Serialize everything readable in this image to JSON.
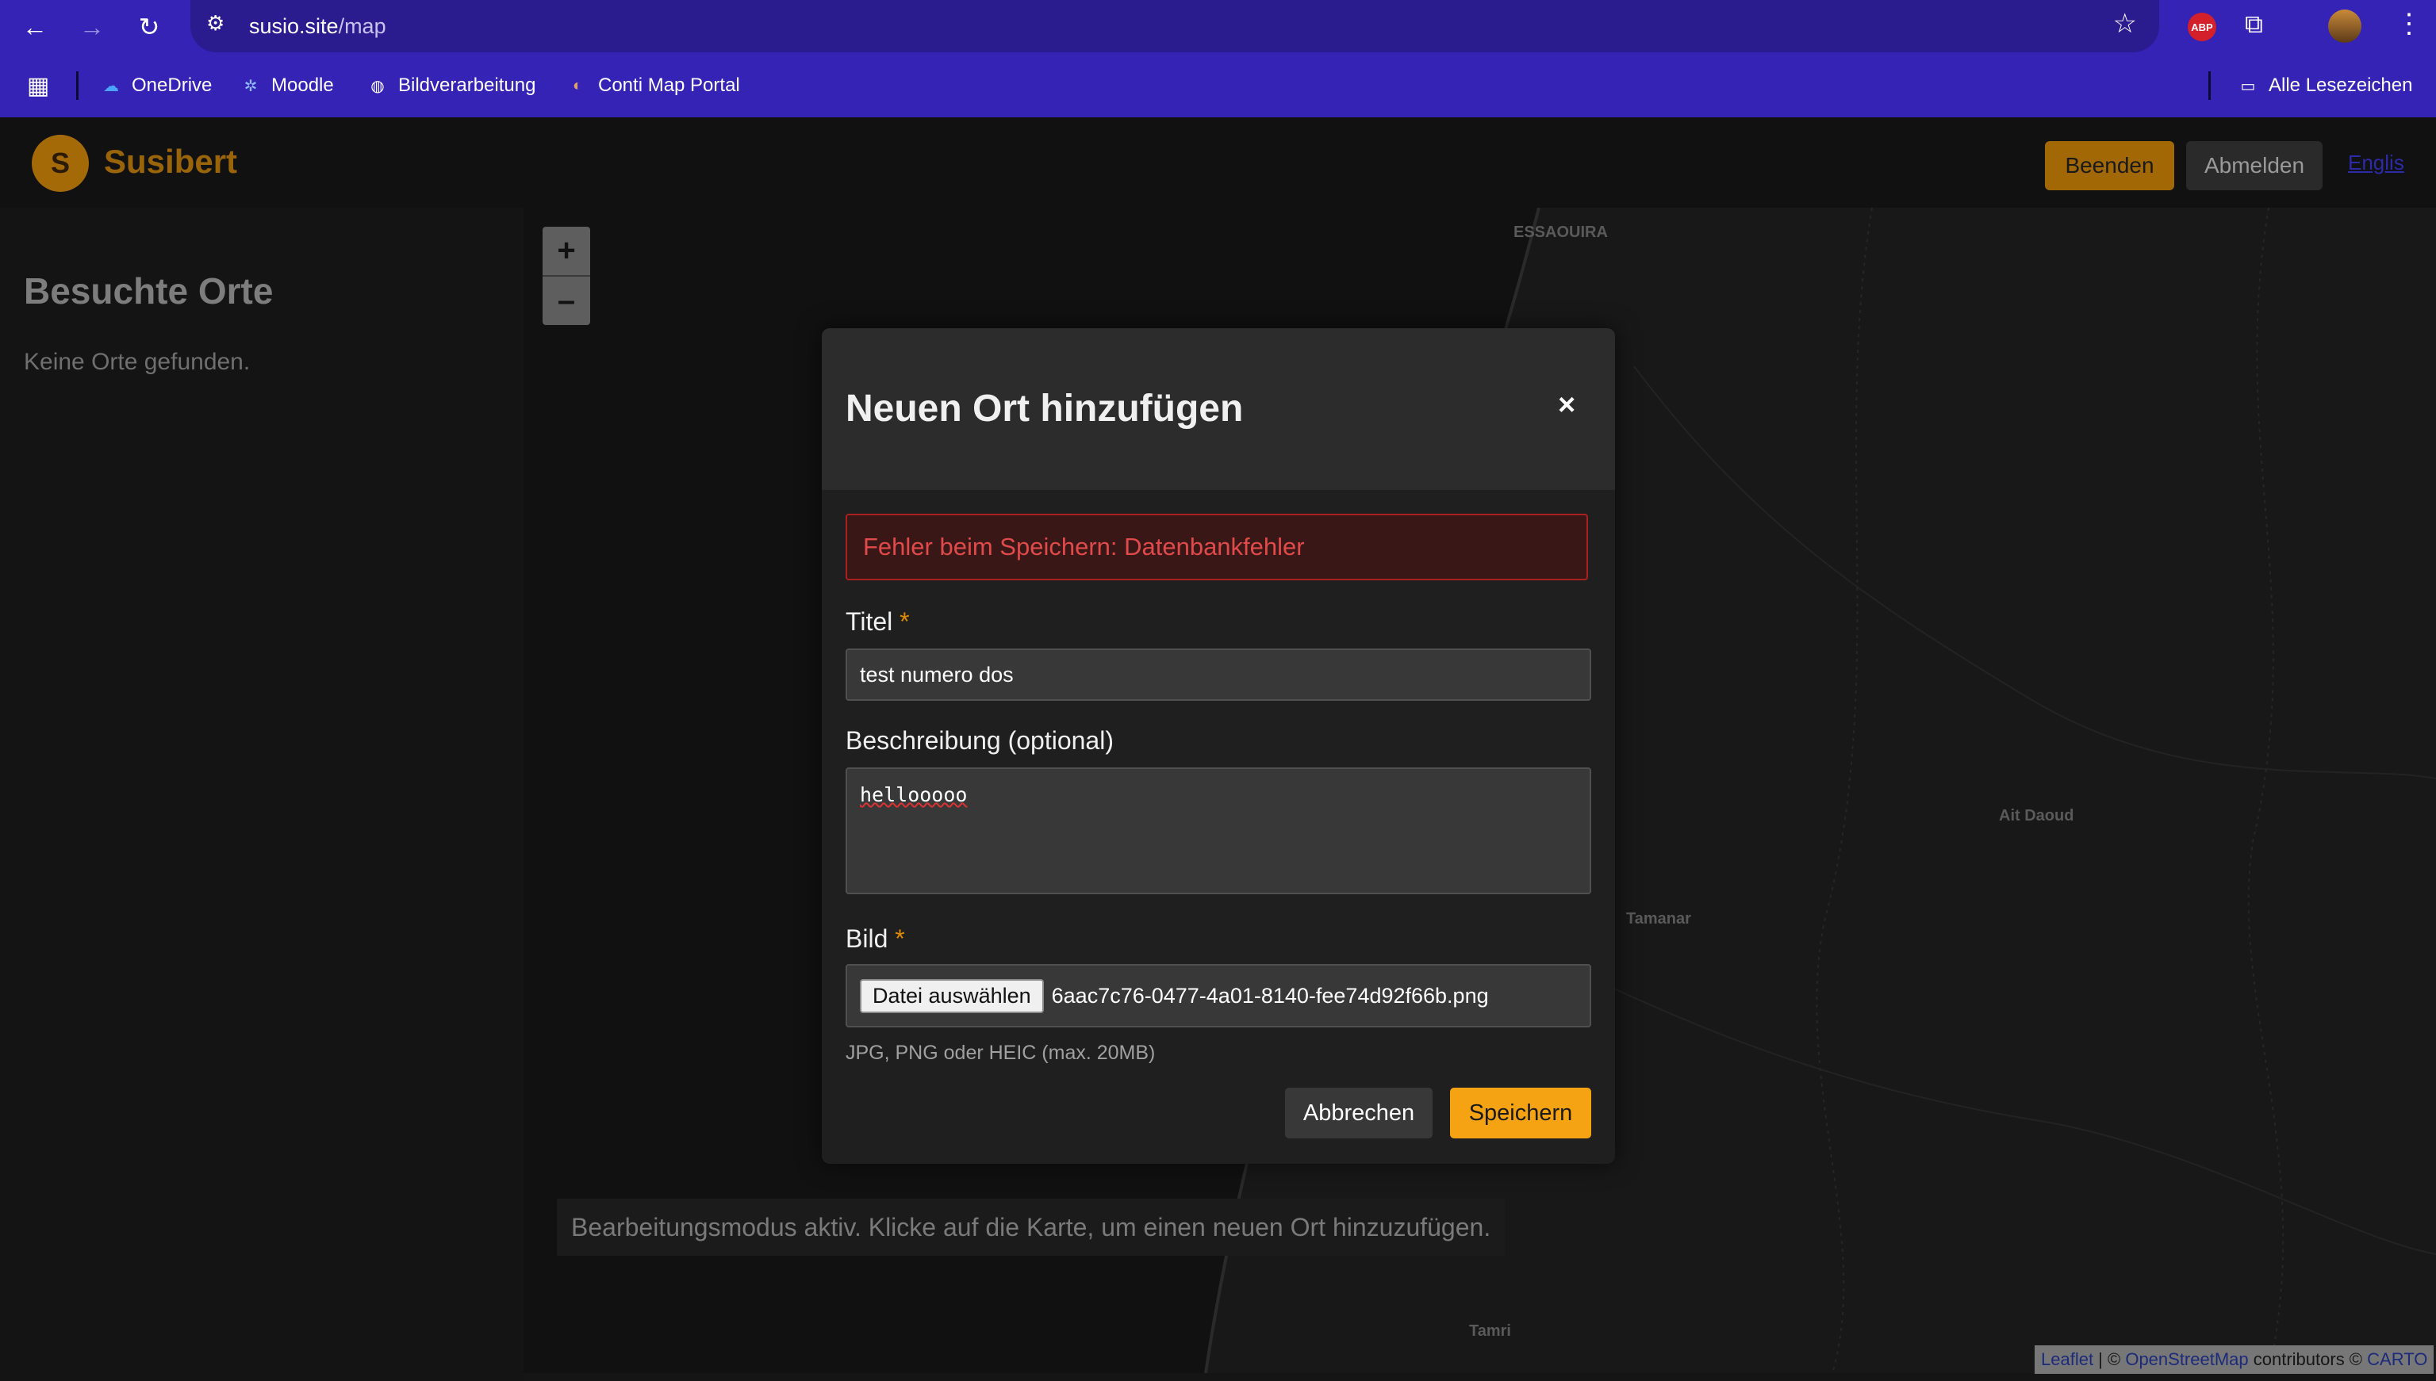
{
  "browser": {
    "url_host": "susio.site",
    "url_path": "/map",
    "bookmarks": [
      {
        "label": "OneDrive"
      },
      {
        "label": "Moodle"
      },
      {
        "label": "Bildverarbeitung"
      },
      {
        "label": "Conti Map Portal"
      }
    ],
    "all_bookmarks_label": "Alle Lesezeichen",
    "abp_label": "ABP"
  },
  "header": {
    "avatar_initial": "S",
    "brand": "Susibert",
    "end_button": "Beenden",
    "logout_button": "Abmelden",
    "lang_link": "Englis"
  },
  "sidebar": {
    "title": "Besuchte Orte",
    "empty_text": "Keine Orte gefunden."
  },
  "map": {
    "zoom_in": "+",
    "zoom_out": "–",
    "labels": [
      "ESSAOUIRA",
      "Ait Daoud",
      "Tamanar",
      "Tamri"
    ],
    "hint": "Bearbeitungsmodus aktiv. Klicke auf die Karte, um einen neuen Ort hinzuzufügen.",
    "attribution": {
      "leaflet": "Leaflet",
      "sep": " | © ",
      "osm": "OpenStreetMap",
      "contributors": " contributors © ",
      "carto": "CARTO"
    }
  },
  "modal": {
    "title": "Neuen Ort hinzufügen",
    "close": "×",
    "error": "Fehler beim Speichern: Datenbankfehler",
    "title_label": "Titel",
    "required_mark": "*",
    "title_value": "test numero dos",
    "desc_label": "Beschreibung (optional)",
    "desc_value": "hellooooo",
    "image_label": "Bild",
    "file_button": "Datei auswählen",
    "file_name": "6aac7c76-0477-4a01-8140-fee74d92f66b.png",
    "file_help": "JPG, PNG oder HEIC (max. 20MB)",
    "cancel": "Abbrechen",
    "save": "Speichern"
  }
}
